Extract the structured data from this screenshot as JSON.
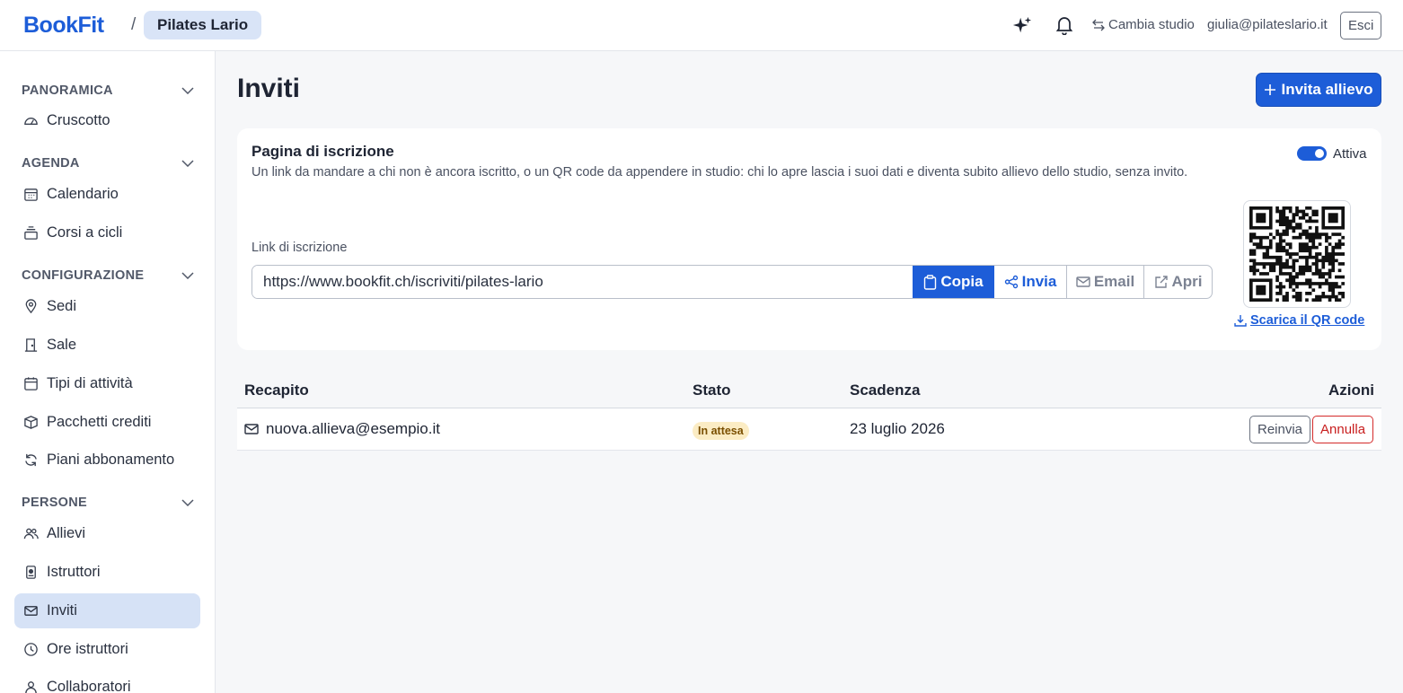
{
  "header": {
    "brand": "BookFit",
    "separator": "/",
    "studio": "Pilates Lario",
    "switch_studio": "Cambia studio",
    "user_email": "giulia@pilateslario.it",
    "logout": "Esci"
  },
  "sidebar": {
    "sections": [
      {
        "title": "PANORAMICA",
        "items": [
          {
            "label": "Cruscotto",
            "icon": "dashboard-icon"
          }
        ]
      },
      {
        "title": "AGENDA",
        "items": [
          {
            "label": "Calendario",
            "icon": "calendar-grid-icon"
          },
          {
            "label": "Corsi a cicli",
            "icon": "stack-icon"
          }
        ]
      },
      {
        "title": "CONFIGURAZIONE",
        "items": [
          {
            "label": "Sedi",
            "icon": "map-pin-icon"
          },
          {
            "label": "Sale",
            "icon": "door-icon"
          },
          {
            "label": "Tipi di attività",
            "icon": "calendar-icon"
          },
          {
            "label": "Pacchetti crediti",
            "icon": "package-icon"
          },
          {
            "label": "Piani abbonamento",
            "icon": "refresh-icon"
          }
        ]
      },
      {
        "title": "PERSONE",
        "items": [
          {
            "label": "Allievi",
            "icon": "users-icon"
          },
          {
            "label": "Istruttori",
            "icon": "badge-icon"
          },
          {
            "label": "Inviti",
            "icon": "envelope-icon",
            "active": true
          },
          {
            "label": "Ore istruttori",
            "icon": "clock-icon"
          },
          {
            "label": "Collaboratori",
            "icon": "user-icon"
          }
        ]
      }
    ]
  },
  "main": {
    "title": "Inviti",
    "invite_button": "Invita allievo",
    "signup_card": {
      "title": "Pagina di iscrizione",
      "description": "Un link da mandare a chi non è ancora iscritto, o un QR code da appendere in studio: chi lo apre lascia i suoi dati e diventa subito allievo dello studio, senza invito.",
      "toggle_label": "Attiva",
      "toggle_on": true,
      "link_label": "Link di iscrizione",
      "link_value": "https://www.bookfit.ch/iscriviti/pilates-lario",
      "buttons": {
        "copy": "Copia",
        "share": "Invia",
        "email": "Email",
        "open": "Apri"
      },
      "qr_download": "Scarica il QR code"
    },
    "table": {
      "columns": [
        "Recapito",
        "Stato",
        "Scadenza",
        "Azioni"
      ],
      "rows": [
        {
          "contact": "nuova.allieva@esempio.it",
          "status": "In attesa",
          "expiry": "23 luglio 2026",
          "actions": {
            "resend": "Reinvia",
            "cancel": "Annulla"
          }
        }
      ]
    }
  },
  "colors": {
    "accent": "#1d5dd8",
    "active_nav": "#d6e2f6",
    "pending_badge": "#fbecc4",
    "danger": "#c81e1e"
  }
}
